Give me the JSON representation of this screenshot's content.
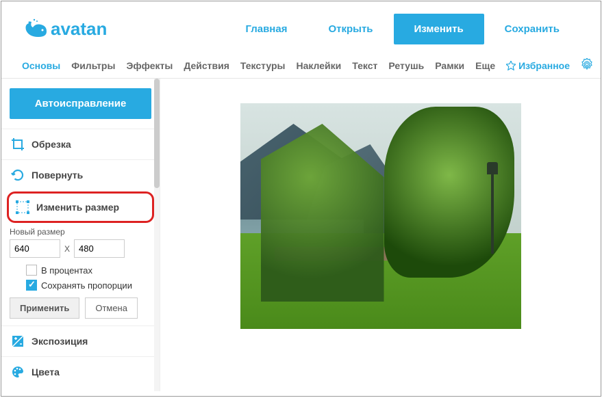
{
  "brand": "avatan",
  "topnav": {
    "home": "Главная",
    "open": "Открыть",
    "edit": "Изменить",
    "save": "Сохранить"
  },
  "toolbar": {
    "basics": "Основы",
    "filters": "Фильтры",
    "effects": "Эффекты",
    "actions": "Действия",
    "textures": "Текстуры",
    "stickers": "Наклейки",
    "text": "Текст",
    "retouch": "Ретушь",
    "frames": "Рамки",
    "more": "Еще",
    "favorites": "Избранное"
  },
  "sidebar": {
    "auto": "Автоисправление",
    "crop": "Обрезка",
    "rotate": "Повернуть",
    "resize": "Изменить размер",
    "exposure": "Экспозиция",
    "colors": "Цвета"
  },
  "resize_panel": {
    "label": "Новый размер",
    "width": "640",
    "height": "480",
    "sep": "X",
    "percent": "В процентах",
    "keep": "Сохранять пропорции",
    "apply": "Применить",
    "cancel": "Отмена"
  },
  "colors": {
    "accent": "#28aae1",
    "highlight": "#d22"
  }
}
